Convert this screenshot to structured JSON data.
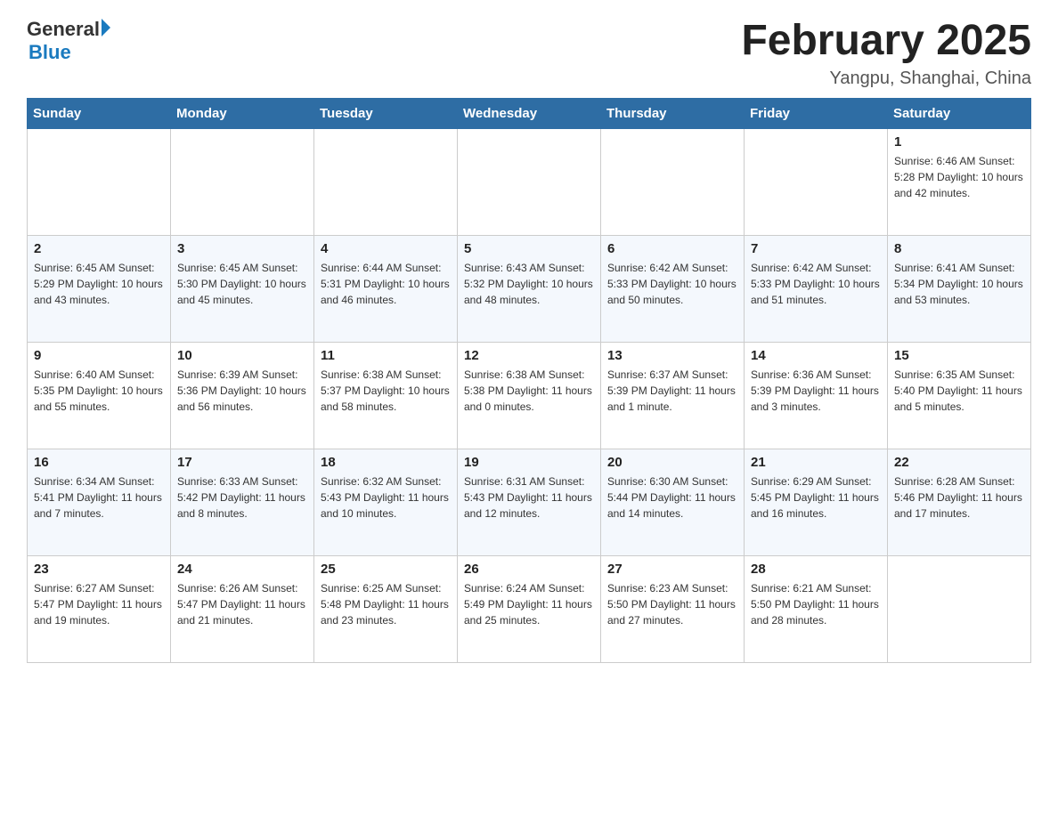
{
  "header": {
    "logo": {
      "general": "General",
      "blue": "Blue"
    },
    "title": "February 2025",
    "subtitle": "Yangpu, Shanghai, China"
  },
  "columns": [
    "Sunday",
    "Monday",
    "Tuesday",
    "Wednesday",
    "Thursday",
    "Friday",
    "Saturday"
  ],
  "weeks": [
    [
      {
        "day": "",
        "info": ""
      },
      {
        "day": "",
        "info": ""
      },
      {
        "day": "",
        "info": ""
      },
      {
        "day": "",
        "info": ""
      },
      {
        "day": "",
        "info": ""
      },
      {
        "day": "",
        "info": ""
      },
      {
        "day": "1",
        "info": "Sunrise: 6:46 AM\nSunset: 5:28 PM\nDaylight: 10 hours and 42 minutes."
      }
    ],
    [
      {
        "day": "2",
        "info": "Sunrise: 6:45 AM\nSunset: 5:29 PM\nDaylight: 10 hours and 43 minutes."
      },
      {
        "day": "3",
        "info": "Sunrise: 6:45 AM\nSunset: 5:30 PM\nDaylight: 10 hours and 45 minutes."
      },
      {
        "day": "4",
        "info": "Sunrise: 6:44 AM\nSunset: 5:31 PM\nDaylight: 10 hours and 46 minutes."
      },
      {
        "day": "5",
        "info": "Sunrise: 6:43 AM\nSunset: 5:32 PM\nDaylight: 10 hours and 48 minutes."
      },
      {
        "day": "6",
        "info": "Sunrise: 6:42 AM\nSunset: 5:33 PM\nDaylight: 10 hours and 50 minutes."
      },
      {
        "day": "7",
        "info": "Sunrise: 6:42 AM\nSunset: 5:33 PM\nDaylight: 10 hours and 51 minutes."
      },
      {
        "day": "8",
        "info": "Sunrise: 6:41 AM\nSunset: 5:34 PM\nDaylight: 10 hours and 53 minutes."
      }
    ],
    [
      {
        "day": "9",
        "info": "Sunrise: 6:40 AM\nSunset: 5:35 PM\nDaylight: 10 hours and 55 minutes."
      },
      {
        "day": "10",
        "info": "Sunrise: 6:39 AM\nSunset: 5:36 PM\nDaylight: 10 hours and 56 minutes."
      },
      {
        "day": "11",
        "info": "Sunrise: 6:38 AM\nSunset: 5:37 PM\nDaylight: 10 hours and 58 minutes."
      },
      {
        "day": "12",
        "info": "Sunrise: 6:38 AM\nSunset: 5:38 PM\nDaylight: 11 hours and 0 minutes."
      },
      {
        "day": "13",
        "info": "Sunrise: 6:37 AM\nSunset: 5:39 PM\nDaylight: 11 hours and 1 minute."
      },
      {
        "day": "14",
        "info": "Sunrise: 6:36 AM\nSunset: 5:39 PM\nDaylight: 11 hours and 3 minutes."
      },
      {
        "day": "15",
        "info": "Sunrise: 6:35 AM\nSunset: 5:40 PM\nDaylight: 11 hours and 5 minutes."
      }
    ],
    [
      {
        "day": "16",
        "info": "Sunrise: 6:34 AM\nSunset: 5:41 PM\nDaylight: 11 hours and 7 minutes."
      },
      {
        "day": "17",
        "info": "Sunrise: 6:33 AM\nSunset: 5:42 PM\nDaylight: 11 hours and 8 minutes."
      },
      {
        "day": "18",
        "info": "Sunrise: 6:32 AM\nSunset: 5:43 PM\nDaylight: 11 hours and 10 minutes."
      },
      {
        "day": "19",
        "info": "Sunrise: 6:31 AM\nSunset: 5:43 PM\nDaylight: 11 hours and 12 minutes."
      },
      {
        "day": "20",
        "info": "Sunrise: 6:30 AM\nSunset: 5:44 PM\nDaylight: 11 hours and 14 minutes."
      },
      {
        "day": "21",
        "info": "Sunrise: 6:29 AM\nSunset: 5:45 PM\nDaylight: 11 hours and 16 minutes."
      },
      {
        "day": "22",
        "info": "Sunrise: 6:28 AM\nSunset: 5:46 PM\nDaylight: 11 hours and 17 minutes."
      }
    ],
    [
      {
        "day": "23",
        "info": "Sunrise: 6:27 AM\nSunset: 5:47 PM\nDaylight: 11 hours and 19 minutes."
      },
      {
        "day": "24",
        "info": "Sunrise: 6:26 AM\nSunset: 5:47 PM\nDaylight: 11 hours and 21 minutes."
      },
      {
        "day": "25",
        "info": "Sunrise: 6:25 AM\nSunset: 5:48 PM\nDaylight: 11 hours and 23 minutes."
      },
      {
        "day": "26",
        "info": "Sunrise: 6:24 AM\nSunset: 5:49 PM\nDaylight: 11 hours and 25 minutes."
      },
      {
        "day": "27",
        "info": "Sunrise: 6:23 AM\nSunset: 5:50 PM\nDaylight: 11 hours and 27 minutes."
      },
      {
        "day": "28",
        "info": "Sunrise: 6:21 AM\nSunset: 5:50 PM\nDaylight: 11 hours and 28 minutes."
      },
      {
        "day": "",
        "info": ""
      }
    ]
  ]
}
